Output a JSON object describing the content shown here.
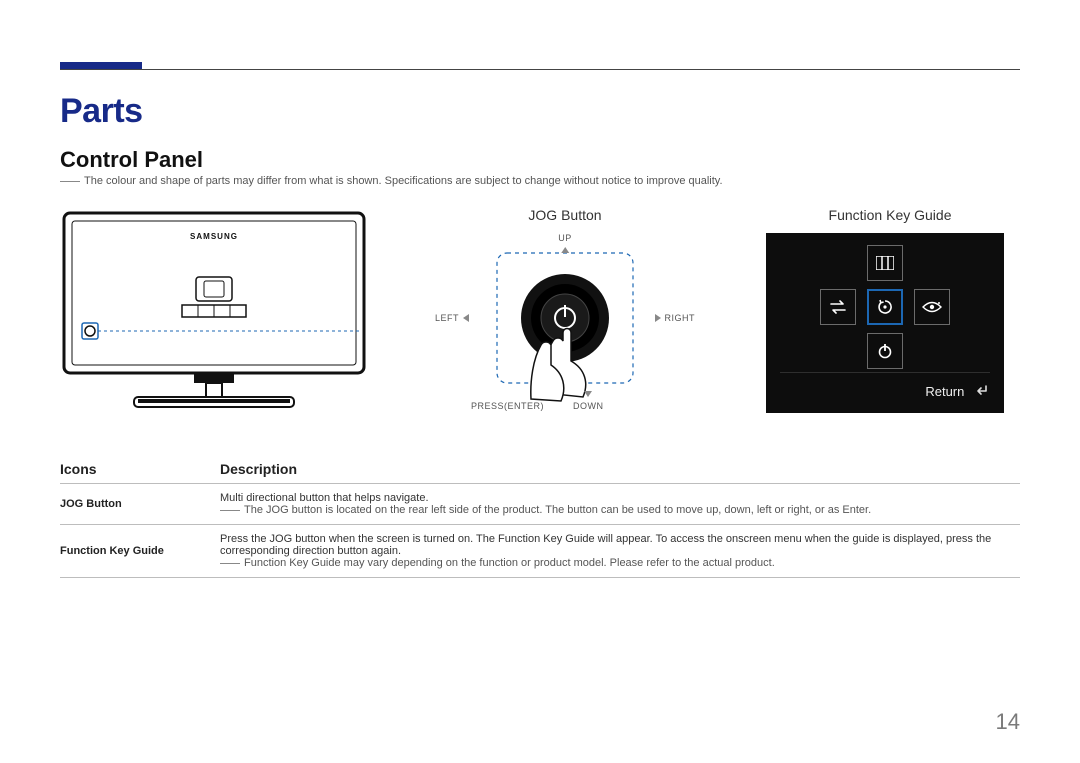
{
  "page": {
    "number": "14",
    "section_title": "Parts",
    "sub_title": "Control Panel",
    "disclaimer": "The colour and shape of parts may differ from what is shown. Specifications are subject to change without notice to improve quality."
  },
  "figure": {
    "monitor_brand": "SAMSUNG",
    "jog_heading": "JOG Button",
    "jog_callouts": {
      "up": "UP",
      "down": "DOWN",
      "left": "LEFT",
      "right": "RIGHT",
      "press": "PRESS(ENTER)"
    },
    "fkg_heading": "Function Key Guide",
    "fkg_return": "Return"
  },
  "table": {
    "col_icons": "Icons",
    "col_desc": "Description",
    "rows": [
      {
        "name": "JOG Button",
        "line1": "Multi directional button that helps navigate.",
        "note": "The JOG button is located on the rear left side of the product. The button can be used to move up, down, left or right, or as Enter."
      },
      {
        "name": "Function Key Guide",
        "line1": "Press the JOG button when the screen is turned on. The Function Key Guide will appear. To access the onscreen menu when the guide is displayed, press the corresponding direction button again.",
        "note": "Function Key Guide may vary depending on the function or product model. Please refer to the actual product."
      }
    ]
  }
}
